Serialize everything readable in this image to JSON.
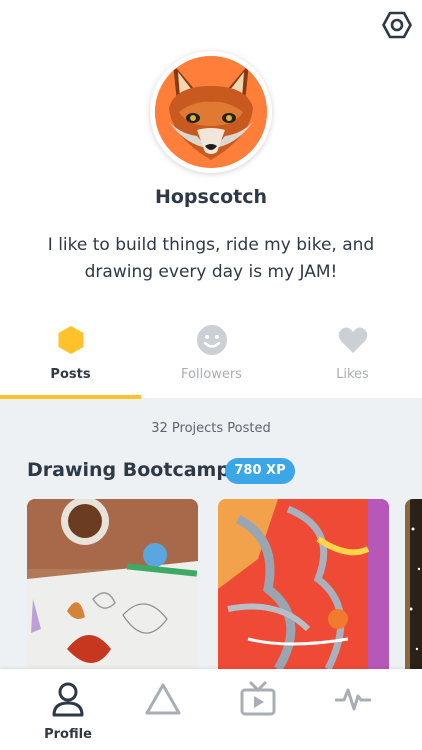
{
  "header": {
    "settings_icon": "hexagon-settings-icon"
  },
  "profile": {
    "avatar_icon": "fox-avatar",
    "username": "Hopscotch",
    "bio": "I like to build things, ride my bike, and drawing every day is my JAM!"
  },
  "tabs": [
    {
      "label": "Posts",
      "icon": "hexagon-icon",
      "active": true
    },
    {
      "label": "Followers",
      "icon": "smiley-icon",
      "active": false
    },
    {
      "label": "Likes",
      "icon": "heart-icon",
      "active": false
    }
  ],
  "content": {
    "projects_count": "32 Projects Posted",
    "section_title": "Drawing Bootcamp",
    "xp_badge": "780 XP"
  },
  "bottom_nav": [
    {
      "label": "Profile",
      "icon": "person-icon",
      "active": true
    },
    {
      "label": "",
      "icon": "triangle-icon",
      "active": false
    },
    {
      "label": "",
      "icon": "tv-play-icon",
      "active": false
    },
    {
      "label": "",
      "icon": "activity-icon",
      "active": false
    }
  ],
  "colors": {
    "accent_yellow": "#ffc22b",
    "badge_blue": "#3ba6e8",
    "text_dark": "#2f3845",
    "text_muted": "#a9aeb5",
    "content_bg": "#eef1f4",
    "avatar_bg": "#ff7f3a"
  }
}
